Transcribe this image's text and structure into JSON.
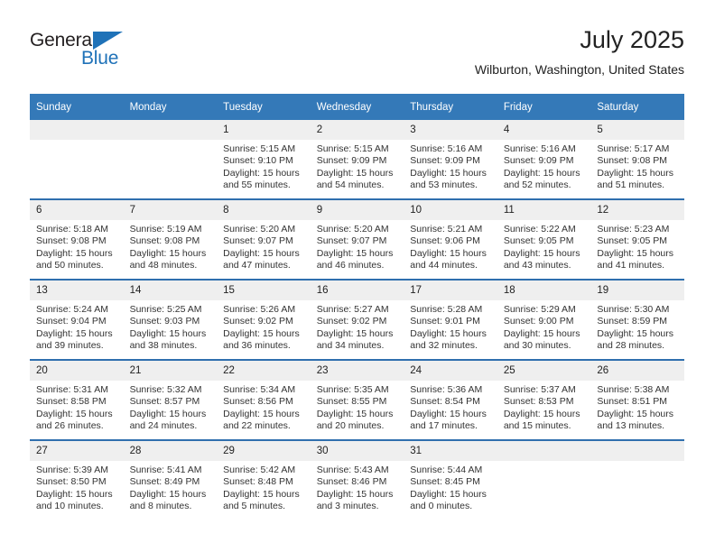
{
  "brand": {
    "name_top": "General",
    "name_bottom": "Blue",
    "accent_color": "#1f72b8"
  },
  "header": {
    "title": "July 2025",
    "location": "Wilburton, Washington, United States"
  },
  "theme": {
    "header_bg": "#3479b8",
    "week_rule": "#2f6fae",
    "daynum_bg": "#efefef",
    "page_bg": "#ffffff"
  },
  "calendar": {
    "weekday_headers": [
      "Sunday",
      "Monday",
      "Tuesday",
      "Wednesday",
      "Thursday",
      "Friday",
      "Saturday"
    ],
    "weeks": [
      [
        {
          "day": "",
          "sunrise": "",
          "sunset": "",
          "daylight_line1": "",
          "daylight_line2": ""
        },
        {
          "day": "",
          "sunrise": "",
          "sunset": "",
          "daylight_line1": "",
          "daylight_line2": ""
        },
        {
          "day": "1",
          "sunrise": "Sunrise: 5:15 AM",
          "sunset": "Sunset: 9:10 PM",
          "daylight_line1": "Daylight: 15 hours",
          "daylight_line2": "and 55 minutes."
        },
        {
          "day": "2",
          "sunrise": "Sunrise: 5:15 AM",
          "sunset": "Sunset: 9:09 PM",
          "daylight_line1": "Daylight: 15 hours",
          "daylight_line2": "and 54 minutes."
        },
        {
          "day": "3",
          "sunrise": "Sunrise: 5:16 AM",
          "sunset": "Sunset: 9:09 PM",
          "daylight_line1": "Daylight: 15 hours",
          "daylight_line2": "and 53 minutes."
        },
        {
          "day": "4",
          "sunrise": "Sunrise: 5:16 AM",
          "sunset": "Sunset: 9:09 PM",
          "daylight_line1": "Daylight: 15 hours",
          "daylight_line2": "and 52 minutes."
        },
        {
          "day": "5",
          "sunrise": "Sunrise: 5:17 AM",
          "sunset": "Sunset: 9:08 PM",
          "daylight_line1": "Daylight: 15 hours",
          "daylight_line2": "and 51 minutes."
        }
      ],
      [
        {
          "day": "6",
          "sunrise": "Sunrise: 5:18 AM",
          "sunset": "Sunset: 9:08 PM",
          "daylight_line1": "Daylight: 15 hours",
          "daylight_line2": "and 50 minutes."
        },
        {
          "day": "7",
          "sunrise": "Sunrise: 5:19 AM",
          "sunset": "Sunset: 9:08 PM",
          "daylight_line1": "Daylight: 15 hours",
          "daylight_line2": "and 48 minutes."
        },
        {
          "day": "8",
          "sunrise": "Sunrise: 5:20 AM",
          "sunset": "Sunset: 9:07 PM",
          "daylight_line1": "Daylight: 15 hours",
          "daylight_line2": "and 47 minutes."
        },
        {
          "day": "9",
          "sunrise": "Sunrise: 5:20 AM",
          "sunset": "Sunset: 9:07 PM",
          "daylight_line1": "Daylight: 15 hours",
          "daylight_line2": "and 46 minutes."
        },
        {
          "day": "10",
          "sunrise": "Sunrise: 5:21 AM",
          "sunset": "Sunset: 9:06 PM",
          "daylight_line1": "Daylight: 15 hours",
          "daylight_line2": "and 44 minutes."
        },
        {
          "day": "11",
          "sunrise": "Sunrise: 5:22 AM",
          "sunset": "Sunset: 9:05 PM",
          "daylight_line1": "Daylight: 15 hours",
          "daylight_line2": "and 43 minutes."
        },
        {
          "day": "12",
          "sunrise": "Sunrise: 5:23 AM",
          "sunset": "Sunset: 9:05 PM",
          "daylight_line1": "Daylight: 15 hours",
          "daylight_line2": "and 41 minutes."
        }
      ],
      [
        {
          "day": "13",
          "sunrise": "Sunrise: 5:24 AM",
          "sunset": "Sunset: 9:04 PM",
          "daylight_line1": "Daylight: 15 hours",
          "daylight_line2": "and 39 minutes."
        },
        {
          "day": "14",
          "sunrise": "Sunrise: 5:25 AM",
          "sunset": "Sunset: 9:03 PM",
          "daylight_line1": "Daylight: 15 hours",
          "daylight_line2": "and 38 minutes."
        },
        {
          "day": "15",
          "sunrise": "Sunrise: 5:26 AM",
          "sunset": "Sunset: 9:02 PM",
          "daylight_line1": "Daylight: 15 hours",
          "daylight_line2": "and 36 minutes."
        },
        {
          "day": "16",
          "sunrise": "Sunrise: 5:27 AM",
          "sunset": "Sunset: 9:02 PM",
          "daylight_line1": "Daylight: 15 hours",
          "daylight_line2": "and 34 minutes."
        },
        {
          "day": "17",
          "sunrise": "Sunrise: 5:28 AM",
          "sunset": "Sunset: 9:01 PM",
          "daylight_line1": "Daylight: 15 hours",
          "daylight_line2": "and 32 minutes."
        },
        {
          "day": "18",
          "sunrise": "Sunrise: 5:29 AM",
          "sunset": "Sunset: 9:00 PM",
          "daylight_line1": "Daylight: 15 hours",
          "daylight_line2": "and 30 minutes."
        },
        {
          "day": "19",
          "sunrise": "Sunrise: 5:30 AM",
          "sunset": "Sunset: 8:59 PM",
          "daylight_line1": "Daylight: 15 hours",
          "daylight_line2": "and 28 minutes."
        }
      ],
      [
        {
          "day": "20",
          "sunrise": "Sunrise: 5:31 AM",
          "sunset": "Sunset: 8:58 PM",
          "daylight_line1": "Daylight: 15 hours",
          "daylight_line2": "and 26 minutes."
        },
        {
          "day": "21",
          "sunrise": "Sunrise: 5:32 AM",
          "sunset": "Sunset: 8:57 PM",
          "daylight_line1": "Daylight: 15 hours",
          "daylight_line2": "and 24 minutes."
        },
        {
          "day": "22",
          "sunrise": "Sunrise: 5:34 AM",
          "sunset": "Sunset: 8:56 PM",
          "daylight_line1": "Daylight: 15 hours",
          "daylight_line2": "and 22 minutes."
        },
        {
          "day": "23",
          "sunrise": "Sunrise: 5:35 AM",
          "sunset": "Sunset: 8:55 PM",
          "daylight_line1": "Daylight: 15 hours",
          "daylight_line2": "and 20 minutes."
        },
        {
          "day": "24",
          "sunrise": "Sunrise: 5:36 AM",
          "sunset": "Sunset: 8:54 PM",
          "daylight_line1": "Daylight: 15 hours",
          "daylight_line2": "and 17 minutes."
        },
        {
          "day": "25",
          "sunrise": "Sunrise: 5:37 AM",
          "sunset": "Sunset: 8:53 PM",
          "daylight_line1": "Daylight: 15 hours",
          "daylight_line2": "and 15 minutes."
        },
        {
          "day": "26",
          "sunrise": "Sunrise: 5:38 AM",
          "sunset": "Sunset: 8:51 PM",
          "daylight_line1": "Daylight: 15 hours",
          "daylight_line2": "and 13 minutes."
        }
      ],
      [
        {
          "day": "27",
          "sunrise": "Sunrise: 5:39 AM",
          "sunset": "Sunset: 8:50 PM",
          "daylight_line1": "Daylight: 15 hours",
          "daylight_line2": "and 10 minutes."
        },
        {
          "day": "28",
          "sunrise": "Sunrise: 5:41 AM",
          "sunset": "Sunset: 8:49 PM",
          "daylight_line1": "Daylight: 15 hours",
          "daylight_line2": "and 8 minutes."
        },
        {
          "day": "29",
          "sunrise": "Sunrise: 5:42 AM",
          "sunset": "Sunset: 8:48 PM",
          "daylight_line1": "Daylight: 15 hours",
          "daylight_line2": "and 5 minutes."
        },
        {
          "day": "30",
          "sunrise": "Sunrise: 5:43 AM",
          "sunset": "Sunset: 8:46 PM",
          "daylight_line1": "Daylight: 15 hours",
          "daylight_line2": "and 3 minutes."
        },
        {
          "day": "31",
          "sunrise": "Sunrise: 5:44 AM",
          "sunset": "Sunset: 8:45 PM",
          "daylight_line1": "Daylight: 15 hours",
          "daylight_line2": "and 0 minutes."
        },
        {
          "day": "",
          "sunrise": "",
          "sunset": "",
          "daylight_line1": "",
          "daylight_line2": ""
        },
        {
          "day": "",
          "sunrise": "",
          "sunset": "",
          "daylight_line1": "",
          "daylight_line2": ""
        }
      ]
    ]
  }
}
